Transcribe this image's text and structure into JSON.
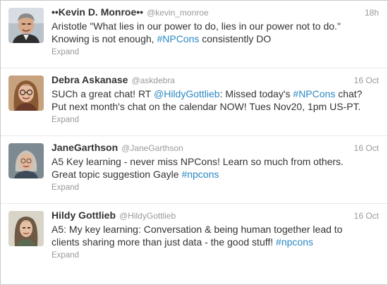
{
  "tweets": [
    {
      "fullname": "••Kevin D. Monroe••",
      "username": "@kevin_monroe",
      "time": "18h",
      "text": [
        {
          "t": "Aristotle \"What lies in our power to do, lies in our power not to do.\" Knowing is not enough, "
        },
        {
          "t": "#NPCons",
          "link": true
        },
        {
          "t": " consistently DO"
        }
      ],
      "expand": "Expand",
      "avatar_icon": "man-gray-hair-avatar"
    },
    {
      "fullname": "Debra Askanase",
      "username": "@askdebra",
      "time": "16 Oct",
      "text": [
        {
          "t": "SUCh a great chat! RT "
        },
        {
          "t": "@HildyGottlieb",
          "link": true
        },
        {
          "t": ": Missed today's "
        },
        {
          "t": "#NPCons",
          "link": true
        },
        {
          "t": " chat? Put next month's chat on the calendar NOW! Tues Nov20, 1pm US-PT."
        }
      ],
      "expand": "Expand",
      "avatar_icon": "woman-glasses-avatar"
    },
    {
      "fullname": "JaneGarthson",
      "username": "@JaneGarthson",
      "time": "16 Oct",
      "text": [
        {
          "t": "A5 Key learning - never miss NPCons! Learn so much from others. Great topic suggestion Gayle "
        },
        {
          "t": "#npcons",
          "link": true
        }
      ],
      "expand": "Expand",
      "avatar_icon": "woman-gray-hair-avatar"
    },
    {
      "fullname": "Hildy Gottlieb",
      "username": "@HildyGottlieb",
      "time": "16 Oct",
      "text": [
        {
          "t": "A5: My key learning: Conversation & being human together lead to clients sharing more than just data - the good stuff! "
        },
        {
          "t": "#npcons",
          "link": true
        }
      ],
      "expand": "Expand",
      "avatar_icon": "woman-long-hair-avatar"
    }
  ],
  "colors": {
    "link": "#2a88c4",
    "meta": "#999999",
    "text": "#333333",
    "divider": "#e8e8e8"
  }
}
